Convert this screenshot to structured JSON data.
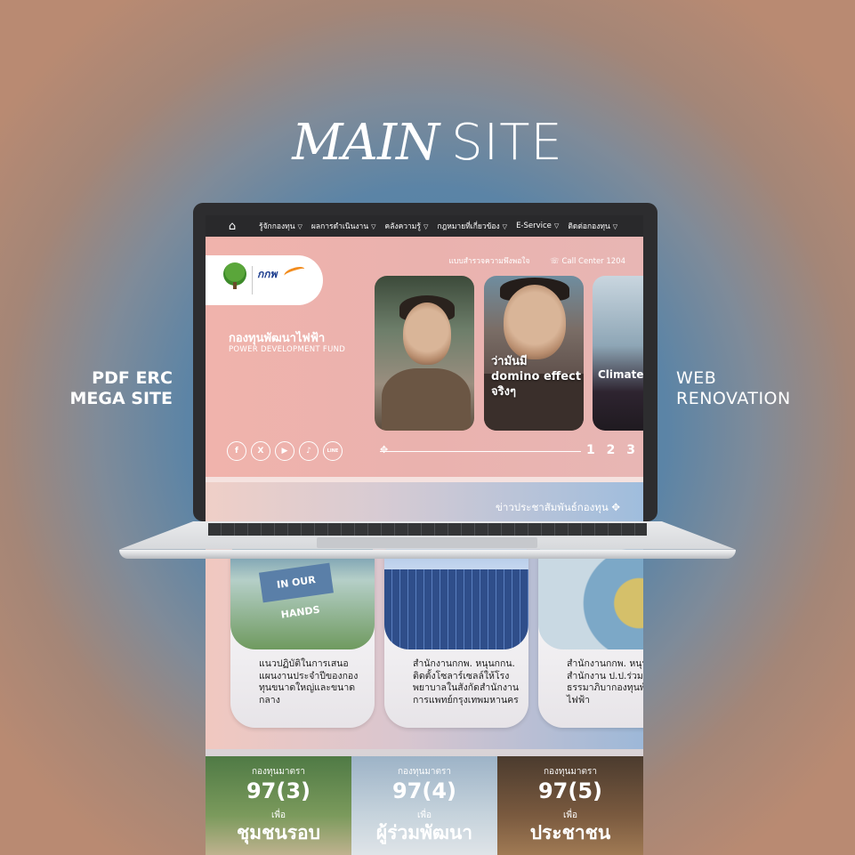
{
  "headline": {
    "italic": "MAIN",
    "regular": "SITE"
  },
  "left_label": {
    "line1": "PDF ERC",
    "line2": "MEGA SITE"
  },
  "right_label": {
    "line1": "WEB",
    "line2": "RENOVATION"
  },
  "nav": {
    "home_icon": "home-icon",
    "items": [
      "รู้จักกองทุน",
      "ผลการดำเนินงาน",
      "คลังความรู้",
      "กฎหมายที่เกี่ยวข้อง",
      "E-Service",
      "ติดต่อกองทุน"
    ]
  },
  "topbar": {
    "survey": "แบบสำรวจความพึงพอใจ",
    "call_center": "Call Center 1204"
  },
  "logo": {
    "mark": "กกพ"
  },
  "hero": {
    "title": "กองทุนพัฒนาไฟฟ้า",
    "subtitle": "POWER DEVELOPMENT FUND",
    "pagination": "1 2 3"
  },
  "socials": [
    "f",
    "X",
    "▶",
    "♪",
    "LINE"
  ],
  "slides": [
    {
      "caption": ""
    },
    {
      "caption_line1": "ว่ามันมี",
      "caption_line2": "domino effect",
      "caption_line3": "จริงๆ"
    },
    {
      "caption": "Climate"
    }
  ],
  "news_strip": {
    "label": "ข่าวประชาสัมพันธ์กองทุน"
  },
  "news": [
    {
      "text": "แนวปฏิบัติในการเสนอแผนงานประจำปีของกองทุนขนาดใหญ่และขนาดกลาง"
    },
    {
      "text": "สำนักงานกกพ. หนุนกกน. ติดตั้งโซลาร์เซลล์ให้โรงพยาบาลในสังกัดสำนักงานการแพทย์กรุงเทพมหานคร"
    },
    {
      "text": "สำนักงานกกพ. หนุนจับมือสำนักงาน ป.ป.ร่วมสร้างธรรมาภิบากองทุนพัฒนาไฟฟ้า"
    }
  ],
  "funds": [
    {
      "small": "กองทุนมาตรา",
      "num": "97(3)",
      "for": "เพื่อ",
      "big": "ชุมชนรอบ"
    },
    {
      "small": "กองทุนมาตรา",
      "num": "97(4)",
      "for": "เพื่อ",
      "big": "ผู้ร่วมพัฒนา"
    },
    {
      "small": "กองทุนมาตรา",
      "num": "97(5)",
      "for": "เพื่อ",
      "big": "ประชาชน"
    }
  ]
}
